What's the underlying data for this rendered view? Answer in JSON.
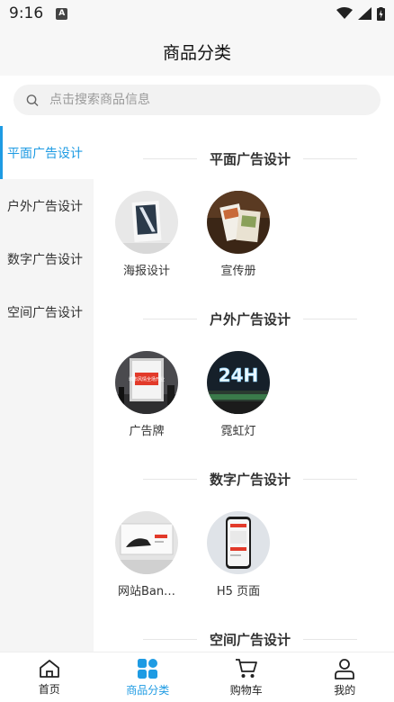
{
  "status": {
    "time": "9:16"
  },
  "header": {
    "title": "商品分类"
  },
  "search": {
    "placeholder": "点击搜索商品信息"
  },
  "sidebar": {
    "items": [
      {
        "label": "平面广告设计",
        "active": true
      },
      {
        "label": "户外广告设计"
      },
      {
        "label": "数字广告设计"
      },
      {
        "label": "空间广告设计"
      }
    ]
  },
  "sections": [
    {
      "title": "平面广告设计",
      "items": [
        {
          "label": "海报设计"
        },
        {
          "label": "宣传册"
        }
      ]
    },
    {
      "title": "户外广告设计",
      "items": [
        {
          "label": "广告牌"
        },
        {
          "label": "霓虹灯"
        }
      ]
    },
    {
      "title": "数字广告设计",
      "items": [
        {
          "label": "网站Ban…"
        },
        {
          "label": "H5 页面"
        }
      ]
    },
    {
      "title": "空间广告设计"
    }
  ],
  "thumb_texts": {
    "billboard": "城市风情全场开业",
    "neon": "24H"
  },
  "tabbar": {
    "items": [
      {
        "label": "首页",
        "icon": "home-icon"
      },
      {
        "label": "商品分类",
        "icon": "category-icon",
        "active": true
      },
      {
        "label": "购物车",
        "icon": "cart-icon"
      },
      {
        "label": "我的",
        "icon": "user-icon"
      }
    ]
  },
  "colors": {
    "accent": "#1e9be3"
  }
}
